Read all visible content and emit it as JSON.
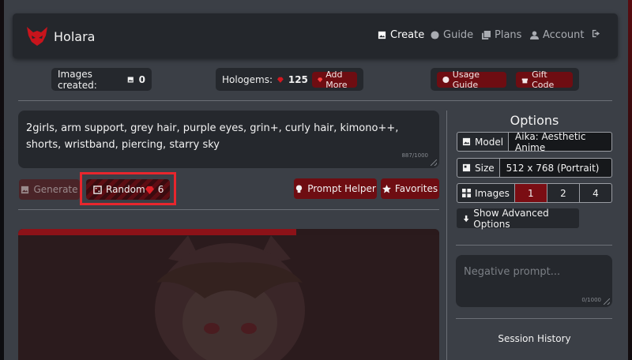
{
  "brand": {
    "name": "Holara"
  },
  "nav": {
    "create": "Create",
    "guide": "Guide",
    "plans": "Plans",
    "account": "Account"
  },
  "stats": {
    "images_created_label": "Images created:",
    "images_created_value": "0",
    "hologems_label": "Hologems:",
    "hologems_value": "125",
    "add_more": "Add More",
    "usage_guide": "Usage Guide",
    "gift_code": "Gift Code"
  },
  "prompt": {
    "text": "2girls, arm support, grey hair, purple eyes, grin+, curly hair, kimono++, shorts, wristband, piercing, starry sky",
    "char_count": "887/1000"
  },
  "actions": {
    "generate": "Generate",
    "random": "Random",
    "random_cost": "6",
    "prompt_helper": "Prompt Helper",
    "favorites": "Favorites"
  },
  "preview": {
    "progress_fraction": 0.66
  },
  "options": {
    "title": "Options",
    "model_label": "Model",
    "model_value": "Aika: Aesthetic Anime",
    "size_label": "Size",
    "size_value": "512 x 768 (Portrait)",
    "images_label": "Images",
    "image_counts": [
      "1",
      "2",
      "4"
    ],
    "images_selected": "1",
    "show_advanced": "Show Advanced Options",
    "negative_placeholder": "Negative prompt...",
    "negative_count": "0/1000",
    "session_history": "Session History"
  },
  "colors": {
    "accent": "#6e0d12",
    "active_segment": "#7a0d13",
    "highlight_outline": "#e8262d"
  }
}
